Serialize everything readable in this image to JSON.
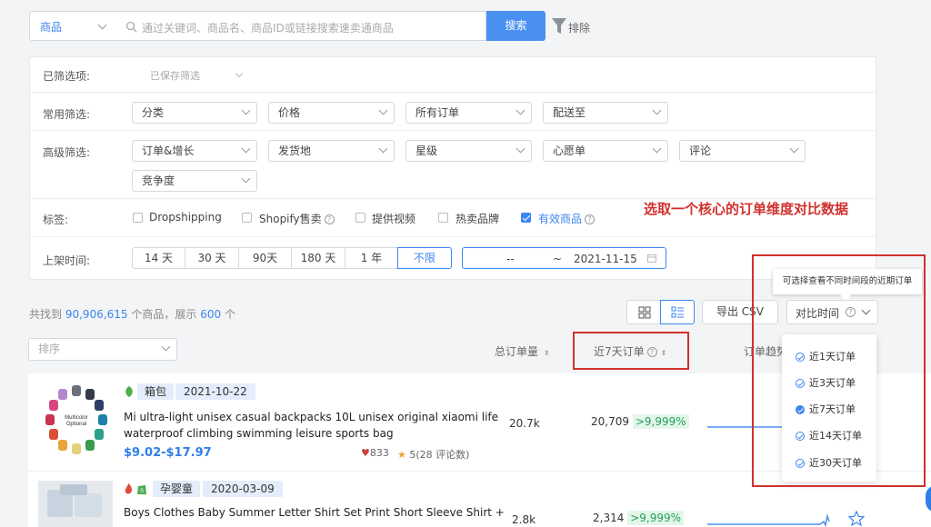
{
  "search": {
    "category_value": "商品",
    "placeholder": "通过关键词、商品名、商品ID或链接搜索速卖通商品",
    "button_label": "搜索",
    "exclude_label": "排除"
  },
  "filters": {
    "selected_label": "已筛选项:",
    "saved_filters": "已保存筛选",
    "common_label": "常用筛选:",
    "common": [
      "分类",
      "价格",
      "所有订单",
      "配送至"
    ],
    "advanced_label": "高级筛选:",
    "advanced": [
      "订单&增长",
      "发货地",
      "星级",
      "心愿单",
      "评论",
      "竞争度"
    ],
    "tags_label": "标签:",
    "tags": [
      {
        "label": "Dropshipping",
        "checked": false
      },
      {
        "label": "Shopify售卖",
        "checked": false
      },
      {
        "label": "提供视频",
        "checked": false
      },
      {
        "label": "热卖品牌",
        "checked": false
      },
      {
        "label": "有效商品",
        "checked": true
      }
    ],
    "listing_label": "上架时间:",
    "time_ranges": [
      "14 天",
      "30 天",
      "90天",
      "180 天",
      "1 年",
      "不限"
    ],
    "selected_range": "不限",
    "date_from": "--",
    "date_sep": "~",
    "date_to": "2021-11-15"
  },
  "annotation": {
    "text": "选取一个核心的订单维度对比数据",
    "color": "#d0312d"
  },
  "results": {
    "prefix": "共找到",
    "total": "90,906,615",
    "mid": "个商品，展示",
    "shown": "600",
    "suffix": "个",
    "export_label": "导出 CSV",
    "compare_label": "对比时间",
    "tooltip": "可选择查看不同时间段的近期订单",
    "sort_placeholder": "排序",
    "col_total_orders": "总订单量",
    "col_7day_orders": "近7天订单",
    "col_trend": "订单趋势"
  },
  "compare_menu": {
    "items": [
      {
        "label": "近1天订单",
        "selected": false
      },
      {
        "label": "近3天订单",
        "selected": false
      },
      {
        "label": "近7天订单",
        "selected": true
      },
      {
        "label": "近14天订单",
        "selected": false
      },
      {
        "label": "近30天订单",
        "selected": false
      }
    ]
  },
  "products": [
    {
      "category": "箱包",
      "date": "2021-10-22",
      "title_line1": "Mi ultra-light unisex casual backpacks 10L unisex original xiaomi life",
      "title_line2": "waterproof climbing swimming leisure sports bag",
      "price": "$9.02-$17.97",
      "wishlist": "833",
      "rating": "5(28 评论数)",
      "total_orders": "20.7k",
      "recent_orders": "20,709",
      "growth": ">9,999%",
      "thumb_text1": "Multicolor",
      "thumb_text2": "Optional"
    },
    {
      "category": "孕婴童",
      "date": "2020-03-09",
      "title_line1": "Boys Clothes Baby Summer Letter Shirt Set Print Short Sleeve Shirt +",
      "total_orders": "2.8k",
      "recent_orders": "2,314",
      "growth": ">9,999%"
    }
  ],
  "colors": {
    "accent": "#3b86f0",
    "annotation_red": "#d0312d",
    "growth_green": "#20a45a",
    "price_blue": "#2f7ee8"
  }
}
